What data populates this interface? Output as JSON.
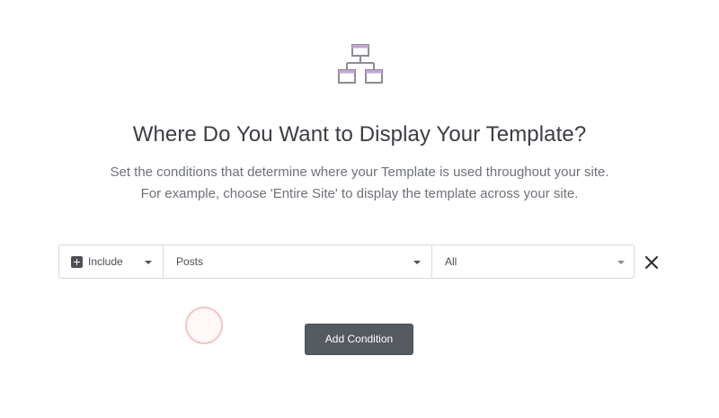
{
  "header": {
    "icon": "sitemap-icon",
    "title": "Where Do You Want to Display Your Template?",
    "description_line1": "Set the conditions that determine where your Template is used throughout your site.",
    "description_line2": "For example, choose 'Entire Site' to display the template across your site."
  },
  "condition": {
    "type_label": "Include",
    "type_icon": "plus-square-icon",
    "name_value": "Posts",
    "sub_value": "All",
    "remove_icon": "close-icon"
  },
  "actions": {
    "add_condition_label": "Add Condition"
  },
  "colors": {
    "accent_icon": "#b483c5",
    "button_bg": "#555a61"
  }
}
